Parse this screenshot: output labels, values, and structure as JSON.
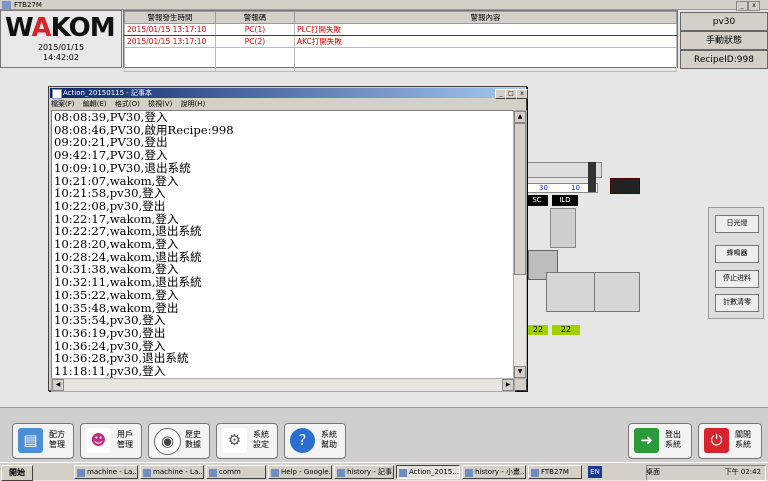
{
  "app": {
    "title": "FTB27M"
  },
  "header": {
    "logo_left": "W",
    "logo_mid": "A",
    "logo_right": "KOM",
    "date": "2015/01/15",
    "time": "14:42:02"
  },
  "alarm": {
    "headers": [
      "警報發生時間",
      "警報碼",
      "警報內容"
    ],
    "rows": [
      {
        "time": "2015/01/15 13:17:10",
        "code": "PC(1)",
        "content": "PLC打開失敗"
      },
      {
        "time": "2015/01/15 13:17:10",
        "code": "PC(2)",
        "content": "AKC打開失敗"
      }
    ]
  },
  "top_right": {
    "user": "pv30",
    "mode": "手動狀態",
    "recipe": "RecipeID:998"
  },
  "machine": {
    "left_val": "30",
    "right_val": "10",
    "left_tag": "SC",
    "right_tag": "ILD",
    "bottom_left": "22",
    "bottom_right": "22"
  },
  "right_panel": {
    "buttons": [
      "日光燈",
      "蜂鳴器",
      "停止进料",
      "計數清零"
    ]
  },
  "notepad": {
    "title": "Action_20150115 - 記事本",
    "menu": [
      "檔案(F)",
      "編輯(E)",
      "格式(O)",
      "檢視(V)",
      "說明(H)"
    ],
    "lines": [
      "08:08:39,PV30,登入",
      "08:08:46,PV30,啟用Recipe:998",
      "09:20:21,PV30,登出",
      "09:42:17,PV30,登入",
      "10:09:10,PV30,退出系統",
      "10:21:07,wakom,登入",
      "10:21:58,pv30,登入",
      "10:22:08,pv30,登出",
      "10:22:17,wakom,登入",
      "10:22:27,wakom,退出系統",
      "10:28:20,wakom,登入",
      "10:28:24,wakom,退出系統",
      "10:31:38,wakom,登入",
      "10:32:11,wakom,退出系統",
      "10:35:22,wakom,登入",
      "10:35:48,wakom,登出",
      "10:35:54,pv30,登入",
      "10:36:19,pv30,登出",
      "10:36:24,pv30,登入",
      "10:36:28,pv30,退出系統",
      "11:18:11,pv30,登入"
    ]
  },
  "nav": {
    "recipe": {
      "line1": "配方",
      "line2": "管理"
    },
    "user": {
      "line1": "用戶",
      "line2": "管理"
    },
    "history": {
      "line1": "歷史",
      "line2": "數據"
    },
    "settings": {
      "line1": "系統",
      "line2": "設定"
    },
    "help": {
      "line1": "系統",
      "line2": "幫助"
    },
    "logout": {
      "line1": "登出",
      "line2": "系統"
    },
    "close": {
      "line1": "關閉",
      "line2": "系統"
    }
  },
  "taskbar": {
    "start": "開始",
    "tasks": [
      "machine - La...",
      "machine - La...",
      "comm",
      "Help - Google...",
      "history - 記事...",
      "Action_2015...",
      "history - 小畫...",
      "FTB27M"
    ],
    "lang": "EN",
    "desktop": "桌面",
    "clock": "下午 02:42"
  },
  "colors": {
    "alarm_text": "#e00000",
    "accent_red": "#d8232a",
    "level_green": "#a0d000"
  }
}
